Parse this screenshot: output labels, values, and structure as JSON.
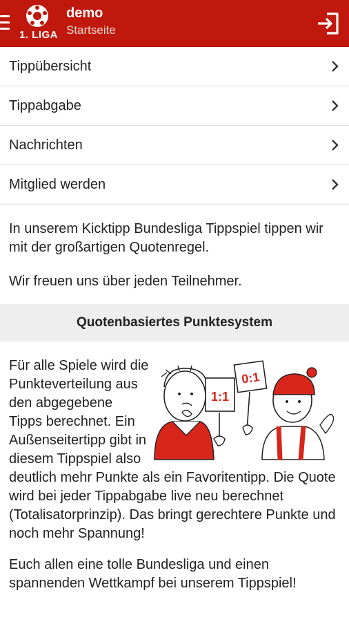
{
  "header": {
    "logo_text": "1. LIGA",
    "title": "demo",
    "subtitle": "Startseite",
    "menu_icon": "hamburger-icon",
    "logout_icon": "logout-icon"
  },
  "menu": {
    "items": [
      {
        "label": "Tippübersicht"
      },
      {
        "label": "Tippabgabe"
      },
      {
        "label": "Nachrichten"
      },
      {
        "label": "Mitglied werden"
      }
    ]
  },
  "intro": {
    "p1": "In unserem Kicktipp Bundesliga Tippspiel tippen wir mit der großartigen Quotenregel.",
    "p2": "Wir freuen uns über jeden Teilnehmer."
  },
  "section": {
    "heading": "Quotenbasiertes Punktesystem",
    "p3": "Für alle Spiele wird die Punkteverteilung aus den abgegebene Tipps berechnet. Ein Außenseitertipp gibt in diesem Tippspiel also deutlich mehr Punkte als ein Favoritentipp. Die Quote wird bei jeder Tippabgabe live neu berechnet (Totalisatorprinzip). Das bringt gerechtere Punkte und noch mehr Spannung!",
    "p4": "Euch allen eine tolle Bundesliga und einen spannenden Wettkampf bei unserem Tippspiel!",
    "sign_left": "1:1",
    "sign_right": "0:1"
  },
  "colors": {
    "brand_red": "#c0180c",
    "section_bg": "#eeeeee"
  }
}
